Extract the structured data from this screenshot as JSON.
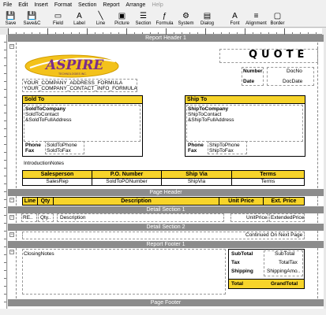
{
  "menu": [
    "File",
    "Edit",
    "Insert",
    "Format",
    "Section",
    "Report",
    "Arrange",
    "Help"
  ],
  "menu_disabled": [
    "Help"
  ],
  "toolbar": [
    {
      "label": "Save",
      "icon": "save-icon",
      "glyph": "💾"
    },
    {
      "label": "Save&C",
      "icon": "save-close-icon",
      "glyph": "💾"
    },
    {
      "label": "Field",
      "icon": "field-icon",
      "glyph": "▭"
    },
    {
      "label": "Label",
      "icon": "label-icon",
      "glyph": "A"
    },
    {
      "label": "Line",
      "icon": "line-icon",
      "glyph": "╲"
    },
    {
      "label": "Picture",
      "icon": "picture-icon",
      "glyph": "▣"
    },
    {
      "label": "Section",
      "icon": "section-icon",
      "glyph": "☰"
    },
    {
      "label": "Formula",
      "icon": "formula-icon",
      "glyph": "ƒ"
    },
    {
      "label": "System",
      "icon": "system-icon",
      "glyph": "⚙"
    },
    {
      "label": "Dialog",
      "icon": "dialog-icon",
      "glyph": "▤"
    },
    {
      "label": "Font",
      "icon": "font-icon",
      "glyph": "A"
    },
    {
      "label": "Alignment",
      "icon": "alignment-icon",
      "glyph": "≡"
    },
    {
      "label": "Border",
      "icon": "border-icon",
      "glyph": "▢"
    }
  ],
  "bands": {
    "report_header": "Report Header 1",
    "page_header": "Page Header",
    "detail1": "Detail Section 1",
    "detail2": "Detail Section 2",
    "report_footer": "Report Footer 1",
    "page_footer": "Page Footer"
  },
  "logo": {
    "text": "ASPIRE",
    "tagline": "TECHNOLOGIES INC."
  },
  "header": {
    "title": "QUOTE",
    "number_label": "Number",
    "number_value": "DocNo",
    "date_label": "Date",
    "date_value": "DocDate",
    "address": "YOUR_COMPANY_ADDRESS_FORMULA",
    "contact": "YOUR_COMPANY_CONTACT_INFO_FORMULA",
    "intro": "IntroductionNotes"
  },
  "sold_to": {
    "heading": "Sold To",
    "lines": [
      "SoldToCompany",
      "SoldToContact",
      "&SoldToFullAddress"
    ],
    "phone_label": "Phone",
    "phone_value": "SoldToPhone",
    "fax_label": "Fax",
    "fax_value": "SoldToFax"
  },
  "ship_to": {
    "heading": "Ship To",
    "lines": [
      "ShipToCompany",
      "ShipToContact",
      "&ShipToFullAddress"
    ],
    "phone_label": "Phone",
    "phone_value": "ShipToPhone",
    "fax_label": "Fax",
    "fax_value": "ShipToFax"
  },
  "info_table": {
    "headers": [
      "Salesperson",
      "P.O. Number",
      "Ship Via",
      "Terms"
    ],
    "values": [
      "SalesRep",
      "SoldToPONumber",
      "ShipVia",
      "Terms"
    ]
  },
  "line_table": {
    "headers": [
      "Line",
      "Qty",
      "Description",
      "Unit Price",
      "Ext. Price"
    ]
  },
  "detail": {
    "line": "RE..",
    "qty": "Qty..",
    "description": "Description",
    "unit_price": "UnitPrice",
    "ext_price": "ExtendedPrice"
  },
  "detail2": {
    "continued": "Continued On Next Page"
  },
  "footer": {
    "closing": "ClosingNotes",
    "subtotal_label": "SubTotal",
    "subtotal_value": "SubTotal",
    "tax_label": "Tax",
    "tax_value": "TotalTax",
    "shipping_label": "Shipping",
    "shipping_value": "ShippingAmo..",
    "total_label": "Total",
    "total_value": "GrandTotal"
  },
  "colors": {
    "accent": "#f7d42a",
    "band": "#8c8c8c"
  }
}
